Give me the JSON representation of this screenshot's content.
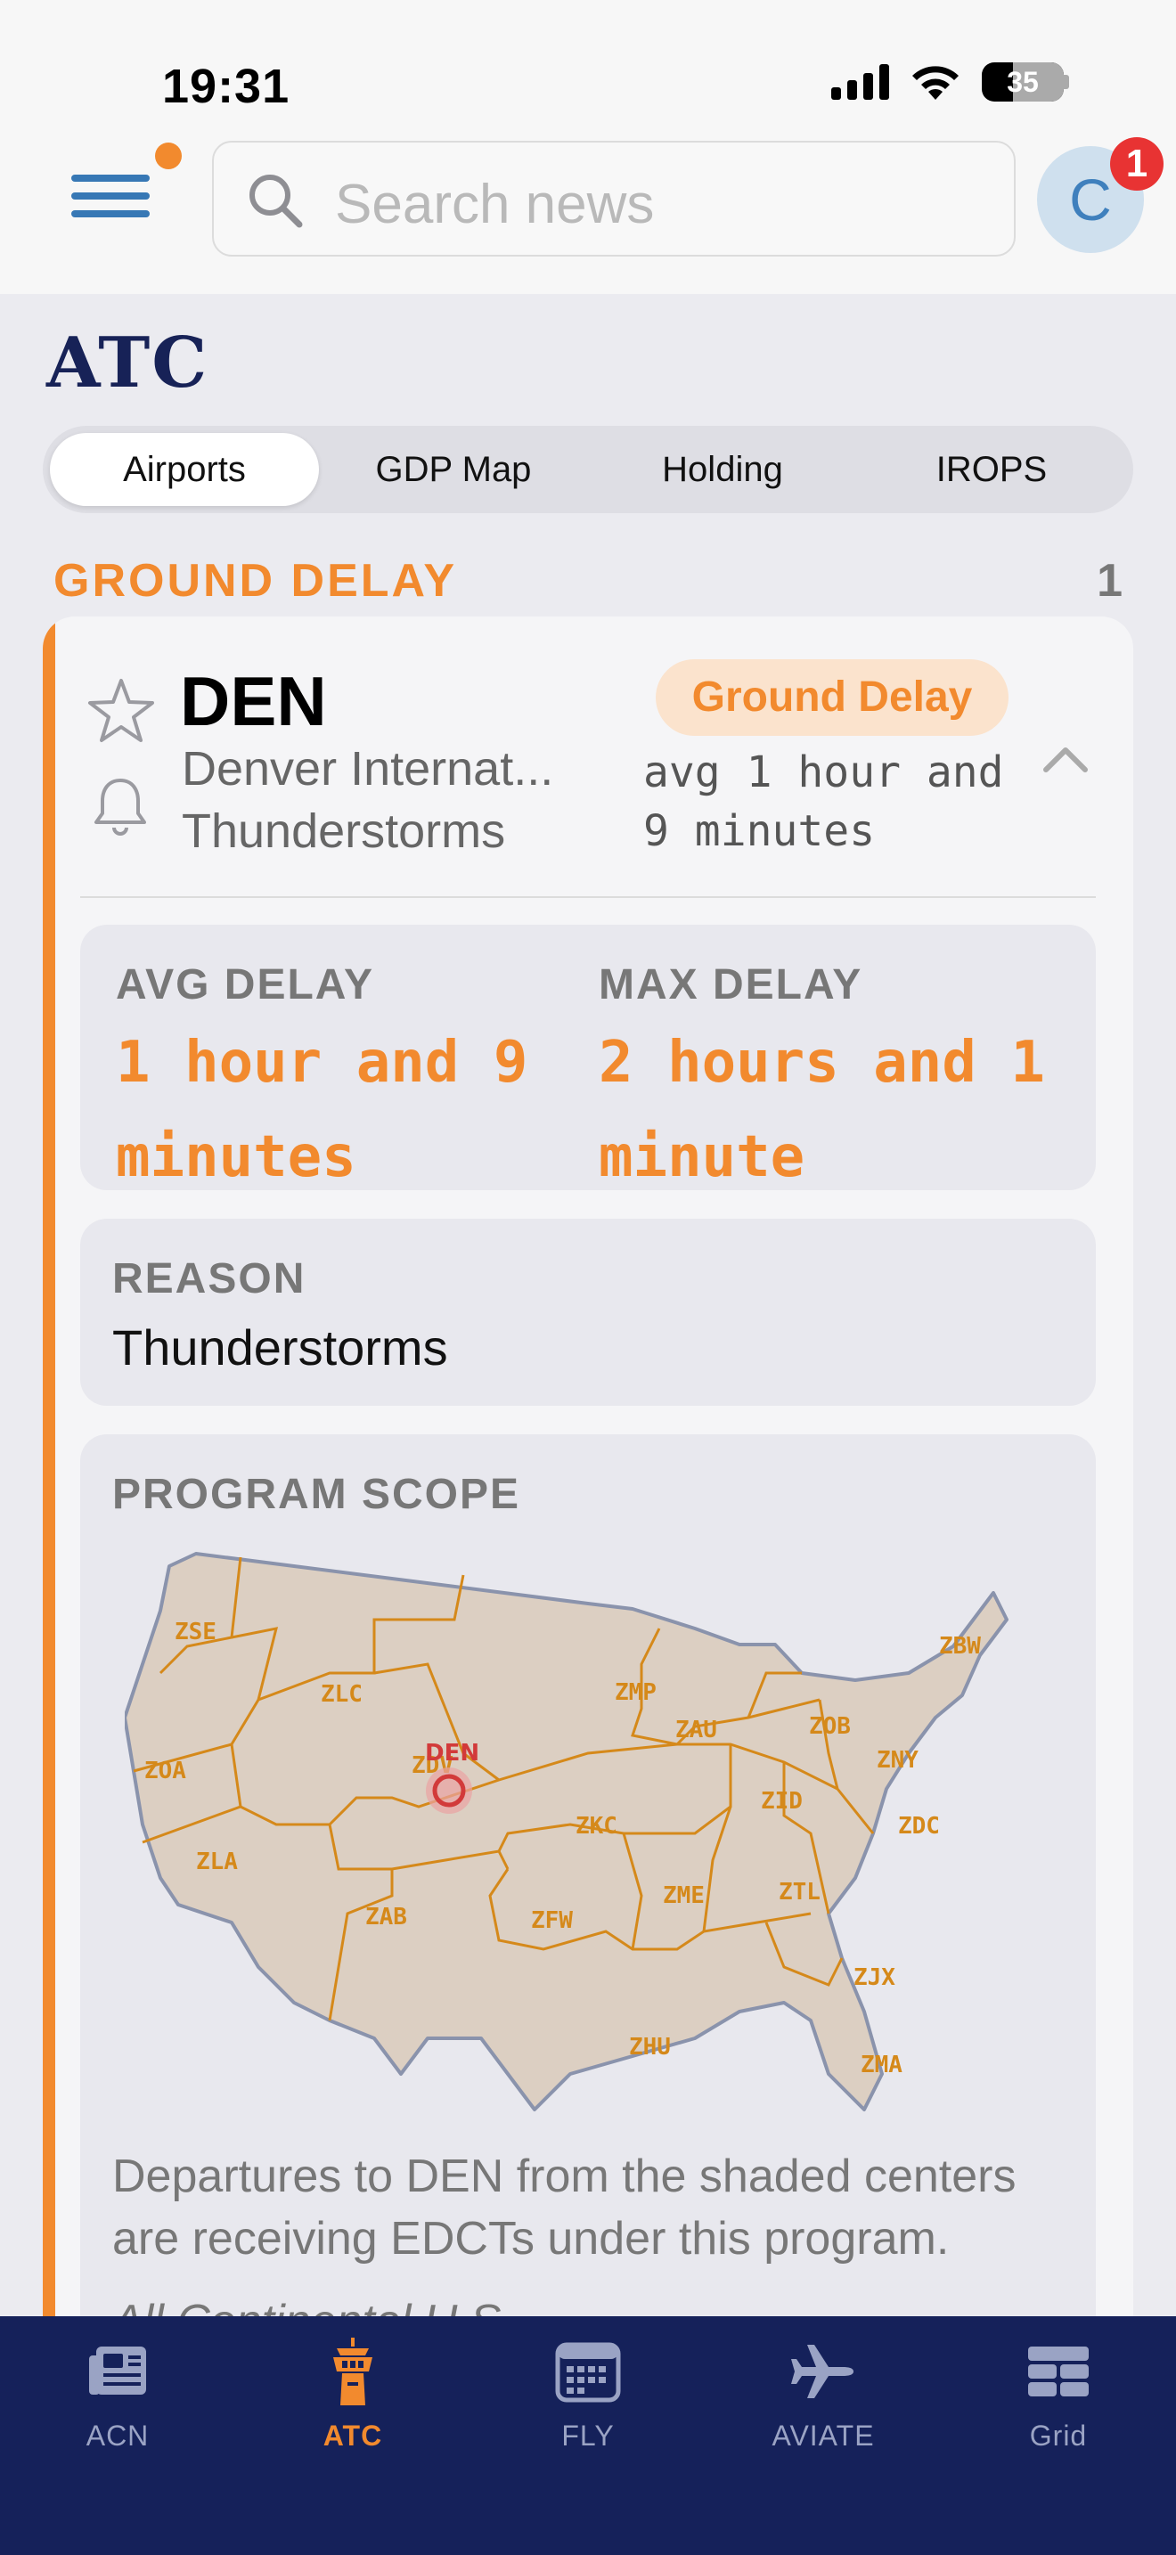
{
  "status": {
    "time": "19:31",
    "battery": "35"
  },
  "header": {
    "search_placeholder": "Search news",
    "avatar_initial": "C",
    "notification_count": "1"
  },
  "page": {
    "title": "ATC"
  },
  "segments": [
    {
      "label": "Airports",
      "active": true
    },
    {
      "label": "GDP Map",
      "active": false
    },
    {
      "label": "Holding",
      "active": false
    },
    {
      "label": "IROPS",
      "active": false
    }
  ],
  "section": {
    "title": "GROUND DELAY",
    "count": "1"
  },
  "program": {
    "code": "DEN",
    "name": "Denver Internat...",
    "reason_short": "Thunderstorms",
    "status_pill": "Ground Delay",
    "avg_summary": "avg 1 hour and 9 minutes",
    "avg_label": "AVG DELAY",
    "avg_value": "1 hour and 9 minutes",
    "max_label": "MAX DELAY",
    "max_value": "2 hours and 1 minute",
    "reason_label": "REASON",
    "reason_value": "Thunderstorms",
    "scope_label": "PROGRAM SCOPE",
    "scope_description": "Departures to DEN from the shaded centers are receiving EDCTs under this program.",
    "scope_note": "All Continental U.S."
  },
  "map": {
    "airport_label": "DEN",
    "centers": [
      "ZSE",
      "ZLC",
      "ZMP",
      "ZAU",
      "ZOB",
      "ZBW",
      "ZNY",
      "ZDC",
      "ZOA",
      "ZDV",
      "ZID",
      "ZKC",
      "ZLA",
      "ZTL",
      "ZME",
      "ZAB",
      "ZFW",
      "ZJX",
      "ZHU",
      "ZMA"
    ],
    "colors": {
      "fill": "#dccfc2",
      "border": "#d5891a",
      "label": "#d5891a",
      "outline": "#8a93ac",
      "airport": "#d23a3a"
    }
  },
  "tabs": [
    {
      "label": "ACN",
      "icon": "newspaper-icon",
      "active": false
    },
    {
      "label": "ATC",
      "icon": "tower-icon",
      "active": true
    },
    {
      "label": "FLY",
      "icon": "calendar-icon",
      "active": false
    },
    {
      "label": "AVIATE",
      "icon": "airplane-icon",
      "active": false
    },
    {
      "label": "Grid",
      "icon": "grid-icon",
      "active": false
    }
  ],
  "colors": {
    "accent": "#f28a2e",
    "navy": "#15215a",
    "brand_title": "#172257"
  }
}
